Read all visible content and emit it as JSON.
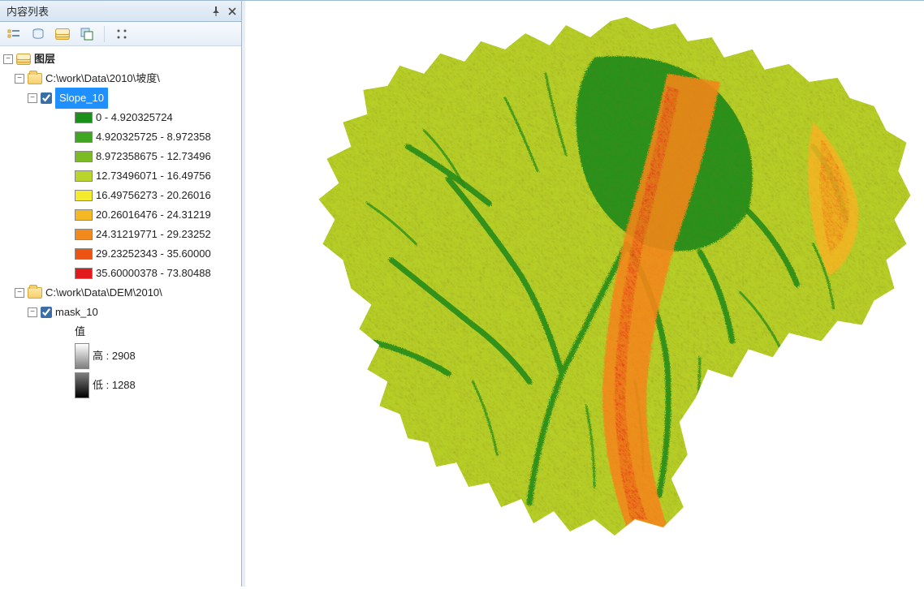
{
  "toc": {
    "title": "内容列表",
    "pin_tooltip": "Auto Hide",
    "close_tooltip": "Close",
    "toolbar": {
      "draw_order": "List By Drawing Order",
      "source": "List By Source",
      "visibility": "List By Visibility",
      "selection": "List By Selection",
      "options": "Options"
    },
    "root_label": "图层",
    "groups": [
      {
        "path": "C:\\work\\Data\\2010\\坡度\\",
        "layers": [
          {
            "name": "Slope_10",
            "checked": true,
            "selected": true,
            "symbology_type": "classified",
            "classes": [
              {
                "color": "#1a8f1a",
                "label": "0 - 4.920325724"
              },
              {
                "color": "#3fa61f",
                "label": "4.920325725 - 8.972358"
              },
              {
                "color": "#7abb24",
                "label": "8.972358675 - 12.73496"
              },
              {
                "color": "#b9d42a",
                "label": "12.73496071 - 16.49756"
              },
              {
                "color": "#f5ea2e",
                "label": "16.49756273 - 20.26016"
              },
              {
                "color": "#f4b824",
                "label": "20.26016476 - 24.31219"
              },
              {
                "color": "#f28a1b",
                "label": "24.31219771 - 29.23252"
              },
              {
                "color": "#ed5412",
                "label": "29.23252343 - 35.60000"
              },
              {
                "color": "#e31a1c",
                "label": "35.60000378 - 73.80488"
              }
            ]
          }
        ]
      },
      {
        "path": "C:\\work\\Data\\DEM\\2010\\",
        "layers": [
          {
            "name": "mask_10",
            "checked": true,
            "selected": false,
            "symbology_type": "stretched",
            "stretch": {
              "title": "值",
              "high_label": "高 : 2908",
              "low_label": "低 : 1288",
              "high_color": "#ffffff",
              "low_color": "#000000"
            }
          }
        ]
      }
    ]
  },
  "map": {
    "active_layer": "Slope_10",
    "colors": {
      "low": "#1a8f1a",
      "mid1": "#7abb24",
      "mid2": "#f5ea2e",
      "mid3": "#f28a1b",
      "high": "#e31a1c"
    }
  }
}
